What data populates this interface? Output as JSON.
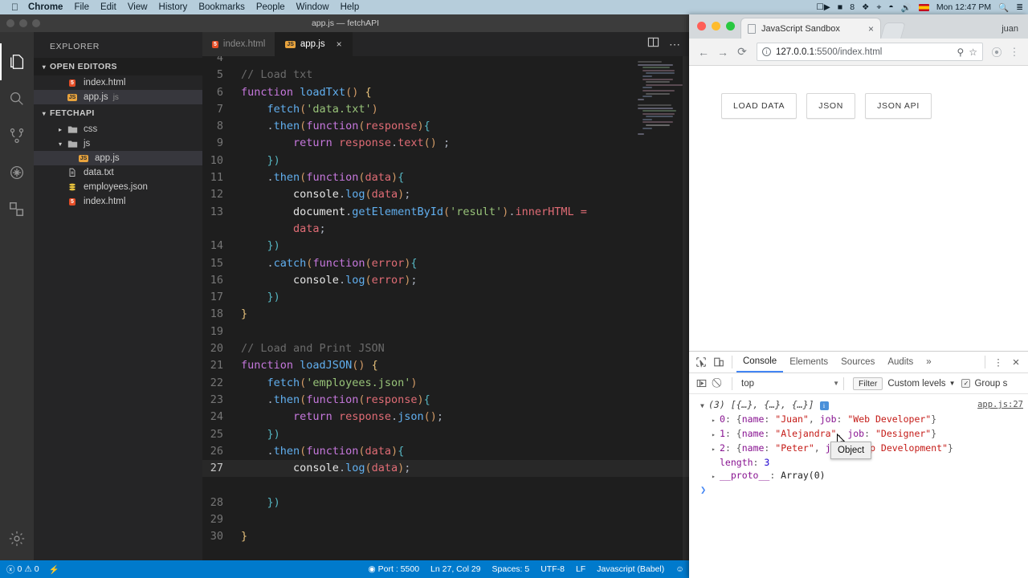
{
  "macbar": {
    "apple_icon": "apple-icon",
    "menus": [
      "Chrome",
      "File",
      "Edit",
      "View",
      "History",
      "Bookmarks",
      "People",
      "Window",
      "Help"
    ],
    "status_items": [
      "screencast-icon",
      "A",
      "8",
      "dropbox-icon",
      "bluetooth-icon",
      "wifi-icon",
      "volume-icon",
      "flag-icon"
    ],
    "battery_count": "8",
    "clock": "Mon 12:47 PM",
    "search_icon": "search-icon",
    "control_center_icon": "list-icon"
  },
  "vscode": {
    "window_title": "app.js — fetchAPI",
    "activity_icons": [
      "files-icon",
      "search-icon",
      "source-control-icon",
      "debug-icon",
      "extensions-icon",
      "settings-gear-icon"
    ],
    "sidebar": {
      "title": "EXPLORER",
      "open_editors": {
        "label": "OPEN EDITORS",
        "items": [
          {
            "name": "index.html",
            "icon": "html-file-icon",
            "suffix": "",
            "selected": false
          },
          {
            "name": "app.js",
            "icon": "js-file-icon",
            "suffix": "js",
            "selected": true
          }
        ]
      },
      "project": {
        "label": "FETCHAPI",
        "items": [
          {
            "name": "css",
            "icon": "folder-icon",
            "type": "folder",
            "expanded": false,
            "indent": 1
          },
          {
            "name": "js",
            "icon": "folder-icon",
            "type": "folder",
            "expanded": true,
            "indent": 1
          },
          {
            "name": "app.js",
            "icon": "js-file-icon",
            "type": "file",
            "indent": 2,
            "selected": true
          },
          {
            "name": "data.txt",
            "icon": "txt-file-icon",
            "type": "file",
            "indent": 1
          },
          {
            "name": "employees.json",
            "icon": "json-file-icon",
            "type": "file",
            "indent": 1
          },
          {
            "name": "index.html",
            "icon": "html-file-icon",
            "type": "file",
            "indent": 1
          }
        ]
      }
    },
    "tabs": [
      {
        "label": "index.html",
        "icon": "html-file-icon",
        "active": false
      },
      {
        "label": "app.js",
        "icon": "js-file-icon",
        "active": true,
        "close_icon": "close-icon"
      }
    ],
    "tab_actions": [
      "split-editor-icon",
      "more-actions-icon"
    ],
    "editor": {
      "first_visible_line": 5,
      "highlighted_line": 27,
      "lines": [
        {
          "n": 5,
          "text": "// Load txt"
        },
        {
          "n": 6,
          "text": "function loadTxt() {"
        },
        {
          "n": 7,
          "text": "    fetch('data.txt')"
        },
        {
          "n": 8,
          "text": "    .then(function(response){"
        },
        {
          "n": 9,
          "text": "        return response.text() ;"
        },
        {
          "n": 10,
          "text": "    })"
        },
        {
          "n": 11,
          "text": "    .then(function(data){"
        },
        {
          "n": 12,
          "text": "        console.log(data);"
        },
        {
          "n": 13,
          "text": "        document.getElementById('result').innerHTML ="
        },
        {
          "n": 13,
          "text": "        data;",
          "continued": true
        },
        {
          "n": 14,
          "text": "    })"
        },
        {
          "n": 15,
          "text": "    .catch(function(error){"
        },
        {
          "n": 16,
          "text": "        console.log(error);"
        },
        {
          "n": 17,
          "text": "    })"
        },
        {
          "n": 18,
          "text": "}"
        },
        {
          "n": 19,
          "text": ""
        },
        {
          "n": 20,
          "text": "// Load and Print JSON"
        },
        {
          "n": 21,
          "text": "function loadJSON() {"
        },
        {
          "n": 22,
          "text": "    fetch('employees.json')"
        },
        {
          "n": 23,
          "text": "    .then(function(response){"
        },
        {
          "n": 24,
          "text": "        return response.json();"
        },
        {
          "n": 25,
          "text": "    })"
        },
        {
          "n": 26,
          "text": "    .then(function(data){"
        },
        {
          "n": 27,
          "text": "        console.log(data);"
        },
        {
          "n": 28,
          "text": "    })"
        },
        {
          "n": 29,
          "text": ""
        },
        {
          "n": 30,
          "text": "}"
        }
      ]
    },
    "statusbar": {
      "errors_icon": "error-circle-icon",
      "errors": "0",
      "warnings_icon": "warning-triangle-icon",
      "warnings": "0",
      "live_icon": "lightning-icon",
      "port": "Port : 5500",
      "cursor": "Ln 27, Col 29",
      "spaces": "Spaces: 5",
      "encoding": "UTF-8",
      "eol": "LF",
      "language": "Javascript (Babel)",
      "smiley_icon": "smiley-icon",
      "accent_color": "#007acc"
    }
  },
  "chrome": {
    "tab": {
      "title": "JavaScript Sandbox",
      "favicon": "page-icon",
      "close_icon": "close-icon"
    },
    "new_tab_icon": "new-tab-icon",
    "profile": "juan",
    "nav": {
      "back_icon": "back-arrow-icon",
      "forward_icon": "forward-arrow-icon",
      "reload_icon": "reload-icon"
    },
    "omnibox": {
      "security_icon": "info-circle-icon",
      "host": "127.0.0.1",
      "path": ":5500/index.html",
      "zoom_icon": "zoom-search-icon",
      "bookmark_icon": "star-icon"
    },
    "extension_icon": "extension-icon",
    "menu_icon": "three-dot-menu-icon",
    "page": {
      "buttons": [
        "LOAD DATA",
        "JSON",
        "JSON API"
      ]
    },
    "devtools": {
      "inspect_icon": "inspect-cursor-icon",
      "device_icon": "device-toolbar-icon",
      "tabs": [
        "Console",
        "Elements",
        "Sources",
        "Audits"
      ],
      "active_tab": "Console",
      "more_tabs_icon": "chevron-double-right-icon",
      "settings_icon": "three-dot-menu-icon",
      "close_icon": "close-icon",
      "toolbar": {
        "execute_icon": "execute-sidebar-icon",
        "clear_icon": "clear-console-icon",
        "context": "top",
        "context_caret": "chevron-down-icon",
        "filter_placeholder": "Filter",
        "levels": "Custom levels",
        "levels_caret": "chevron-down-icon",
        "group_similar": "Group s",
        "group_similar_checked": true
      },
      "console": {
        "source_link": "app.js:27",
        "array_header": "(3) [{…}, {…}, {…}]",
        "info_badge": "i",
        "entries": [
          {
            "index": "0",
            "name": "Juan",
            "job": "Web Developer"
          },
          {
            "index": "1",
            "name": "Alejandra",
            "job": "Designer"
          },
          {
            "index": "2",
            "name": "Peter",
            "job": "App Development"
          }
        ],
        "length_key": "length",
        "length_value": "3",
        "proto_key": "__proto__",
        "proto_value": "Array(0)",
        "tooltip": "Object",
        "prompt_icon": "chevron-right-icon"
      }
    }
  }
}
